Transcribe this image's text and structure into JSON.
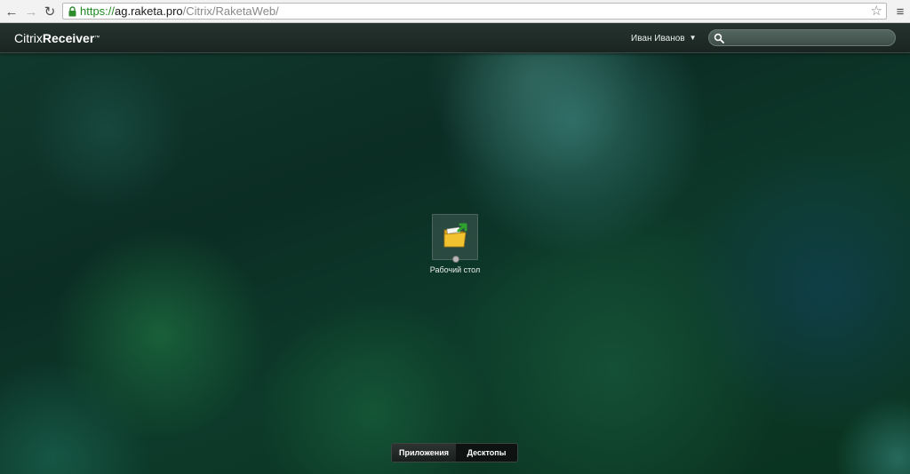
{
  "browser": {
    "url_scheme": "https://",
    "url_host": "ag.raketa.pro",
    "url_path": "/Citrix/RaketaWeb/",
    "icons": [
      "back-icon",
      "forward-icon",
      "reload-icon",
      "lock-icon",
      "star-icon",
      "menu-icon"
    ],
    "glyphs": {
      "back": "←",
      "forward": "→",
      "reload": "↻",
      "star": "☆",
      "menu": "≡"
    }
  },
  "header": {
    "brand_part1": "Citrix",
    "brand_part2": "Receiver",
    "brand_tm": "™",
    "user_name": "Иван Иванов",
    "caret": "▼",
    "search_placeholder": ""
  },
  "desktops": [
    {
      "label": "Рабочий стол",
      "icon": "desktop-folder-icon",
      "status": "offline"
    }
  ],
  "tabs": [
    {
      "label": "Приложения",
      "active": true
    },
    {
      "label": "Десктопы",
      "active": false
    }
  ],
  "colors": {
    "brand_text": "#ffffff",
    "secure_url": "#1f8a1f",
    "topbar": "#1f2b27",
    "background": "#0b2d24"
  }
}
